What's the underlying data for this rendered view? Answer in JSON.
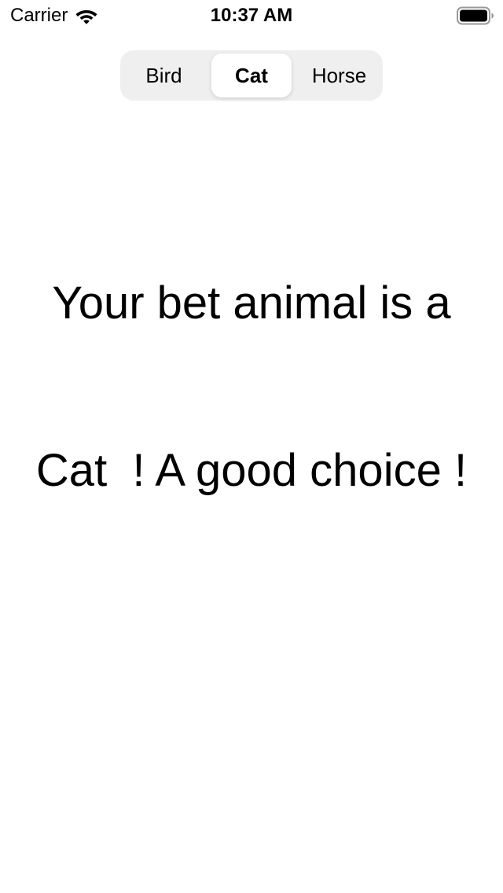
{
  "status_bar": {
    "carrier": "Carrier",
    "time": "10:37 AM",
    "wifi_icon": "wifi-icon",
    "battery_icon": "battery-icon"
  },
  "segmented_control": {
    "segments": [
      {
        "label": "Bird",
        "selected": false
      },
      {
        "label": "Cat",
        "selected": true
      },
      {
        "label": "Horse",
        "selected": false
      }
    ]
  },
  "main": {
    "message_line1": "Your bet animal is a",
    "message_line2": "Cat  ! A good choice !"
  }
}
